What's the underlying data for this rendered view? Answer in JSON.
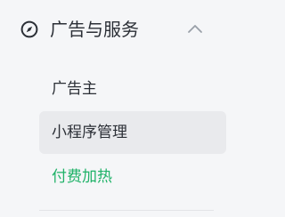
{
  "menu": {
    "title": "广告与服务",
    "icon": "compass-icon",
    "expanded": true,
    "items": [
      {
        "label": "广告主",
        "active": false
      },
      {
        "label": "小程序管理",
        "active": true
      },
      {
        "label": "付费加热",
        "active": false,
        "highlight": true
      }
    ]
  },
  "colors": {
    "text": "#2b2f36",
    "accent": "#1fb268",
    "selected_bg": "#e9eaed",
    "background": "#f5f6f8"
  }
}
